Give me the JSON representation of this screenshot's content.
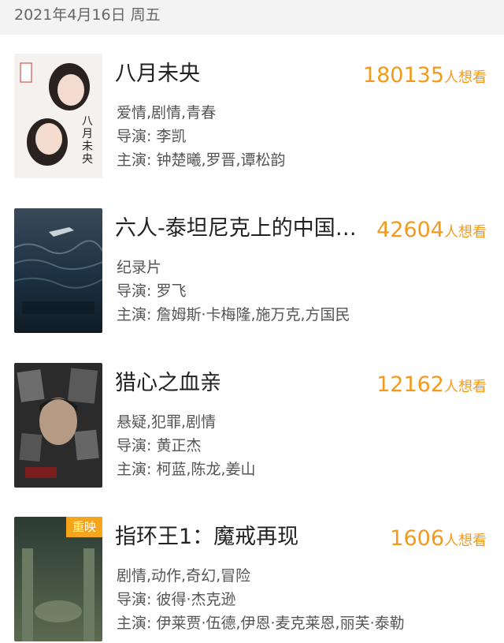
{
  "date_header": "2021年4月16日 周五",
  "want_unit": "人想看",
  "movies": [
    {
      "title": "八月未央",
      "want_count": "180135",
      "genres": "爱情,剧情,青春",
      "director": "导演: 李凯",
      "cast": "主演: 钟楚曦,罗晋,谭松韵",
      "badge": ""
    },
    {
      "title": "六人-泰坦尼克上的中国幸存者",
      "want_count": "42604",
      "genres": "纪录片",
      "director": "导演: 罗飞",
      "cast": "主演: 詹姆斯·卡梅隆,施万克,方国民",
      "badge": ""
    },
    {
      "title": "猎心之血亲",
      "want_count": "12162",
      "genres": "悬疑,犯罪,剧情",
      "director": "导演: 黄正杰",
      "cast": "主演: 柯蓝,陈龙,姜山",
      "badge": ""
    },
    {
      "title": "指环王1：魔戒再现",
      "want_count": "1606",
      "genres": "剧情,动作,奇幻,冒险",
      "director": "导演: 彼得·杰克逊",
      "cast": "主演: 伊莱贾·伍德,伊恩·麦克莱恩,丽芙·泰勒",
      "badge": "重映"
    }
  ]
}
